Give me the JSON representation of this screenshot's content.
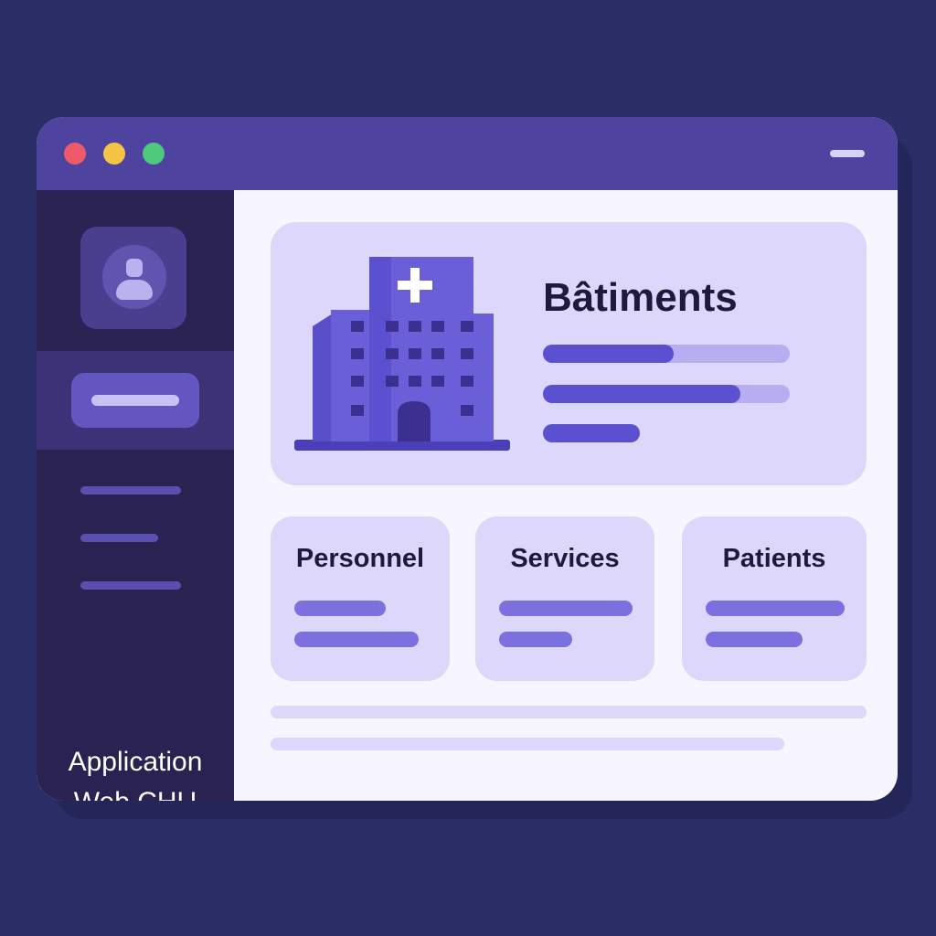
{
  "window": {
    "traffic_lights": [
      "#ef5a6a",
      "#f6c445",
      "#4cc97a"
    ],
    "titlebar_color": "#4f43a0",
    "menu_icon": "hamburger-icon"
  },
  "sidebar": {
    "avatar_icon": "user-avatar-icon",
    "title_line1": "Application",
    "title_line2": "Web CHU"
  },
  "hero": {
    "icon": "hospital-building-icon",
    "title": "Bâtiments",
    "progress": [
      0.53,
      0.8
    ]
  },
  "cards": [
    {
      "title": "Personnel"
    },
    {
      "title": "Services"
    },
    {
      "title": "Patients"
    }
  ],
  "colors": {
    "background": "#2b2d66",
    "accent": "#5b50cf",
    "card": "#dcd7fb",
    "sidebar": "#2a2250"
  }
}
